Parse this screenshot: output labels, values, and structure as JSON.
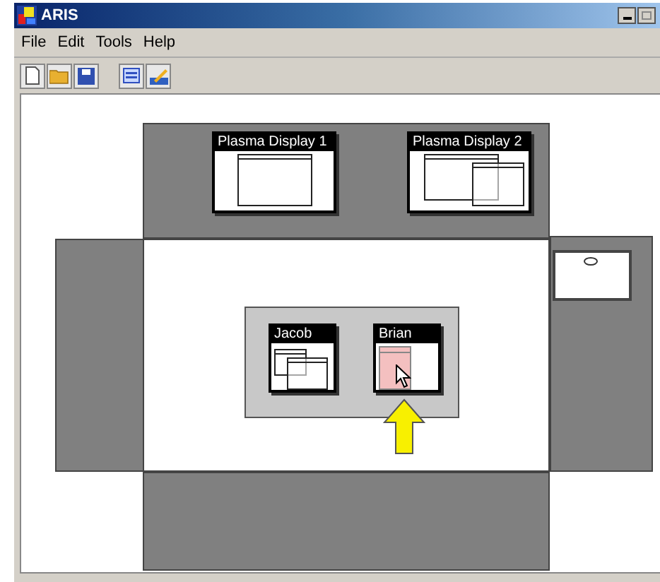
{
  "window": {
    "title": "ARIS"
  },
  "menu": [
    "File",
    "Edit",
    "Tools",
    "Help"
  ],
  "displays": [
    {
      "label": "Plasma Display 1",
      "kind": "single"
    },
    {
      "label": "Plasma Display 2",
      "kind": "dual"
    }
  ],
  "users": [
    {
      "label": "Jacob",
      "selected": false
    },
    {
      "label": "Brian",
      "selected": true
    }
  ]
}
